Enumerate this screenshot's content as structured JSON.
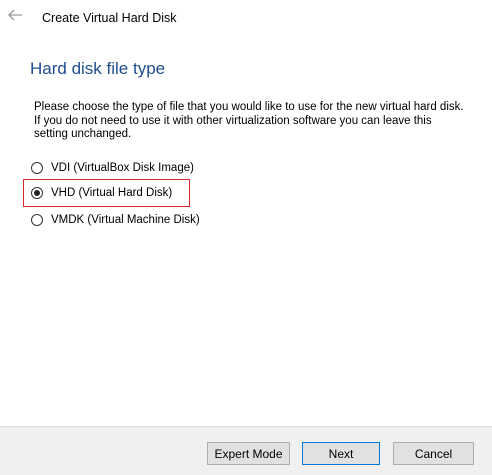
{
  "window": {
    "title": "Create Virtual Hard Disk",
    "back_icon": "back-arrow-icon"
  },
  "page": {
    "heading": "Hard disk file type",
    "description": "Please choose the type of file that you would like to use for the new virtual hard disk. If you do not need to use it with other virtualization software you can leave this setting unchanged."
  },
  "options": [
    {
      "label": "VDI (VirtualBox Disk Image)",
      "selected": false
    },
    {
      "label": "VHD (Virtual Hard Disk)",
      "selected": true
    },
    {
      "label": "VMDK (Virtual Machine Disk)",
      "selected": false
    }
  ],
  "buttons": {
    "expert_mode": "Expert Mode",
    "next": "Next",
    "cancel": "Cancel"
  },
  "colors": {
    "heading": "#1e4e8c",
    "highlight": "#d9262b",
    "focus": "#0078d7",
    "footer_bg": "#f0f0f0"
  }
}
